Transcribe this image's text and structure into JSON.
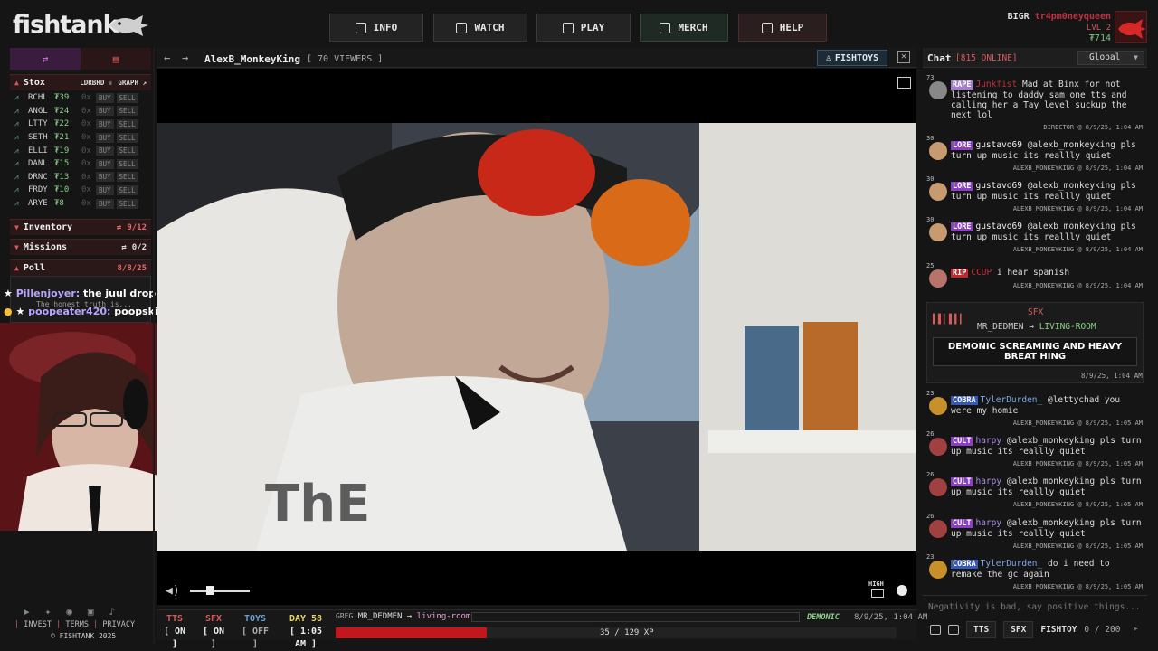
{
  "brand": {
    "logo_text": "fishtank"
  },
  "nav": {
    "info": "INFO",
    "watch": "WATCH",
    "play": "PLAY",
    "merch": "MERCH",
    "help": "HELP"
  },
  "user": {
    "name_prefix": "BIGR",
    "name": "tr4pm0neyqueen",
    "level": "LVL 2",
    "coins": "₮714"
  },
  "left_panel": {
    "stox": {
      "title": "Stox",
      "leaderboard_label": "LDRBRD",
      "graph_label": "GRAPH",
      "rows": [
        {
          "ticker": "RCHL",
          "price": "₮39",
          "owned": "0x",
          "buy": "BUY",
          "sell": "SELL"
        },
        {
          "ticker": "ANGL",
          "price": "₮24",
          "owned": "0x",
          "buy": "BUY",
          "sell": "SELL"
        },
        {
          "ticker": "LTTY",
          "price": "₮22",
          "owned": "0x",
          "buy": "BUY",
          "sell": "SELL"
        },
        {
          "ticker": "SETH",
          "price": "₮21",
          "owned": "0x",
          "buy": "BUY",
          "sell": "SELL"
        },
        {
          "ticker": "ELLI",
          "price": "₮19",
          "owned": "0x",
          "buy": "BUY",
          "sell": "SELL"
        },
        {
          "ticker": "DANL",
          "price": "₮15",
          "owned": "0x",
          "buy": "BUY",
          "sell": "SELL"
        },
        {
          "ticker": "DRNC",
          "price": "₮13",
          "owned": "0x",
          "buy": "BUY",
          "sell": "SELL"
        },
        {
          "ticker": "FRDY",
          "price": "₮10",
          "owned": "0x",
          "buy": "BUY",
          "sell": "SELL"
        },
        {
          "ticker": "ARYE",
          "price": "₮8",
          "owned": "0x",
          "buy": "BUY",
          "sell": "SELL"
        }
      ]
    },
    "inventory": {
      "title": "Inventory",
      "count": "9/12"
    },
    "missions": {
      "title": "Missions",
      "count": "0/2"
    },
    "poll": {
      "title": "Poll",
      "date": "8/8/25"
    },
    "overlay_chat": [
      {
        "name": "Pillenjoyer:",
        "text": "the juul drop lol"
      },
      {
        "sub": "The honest truth is..."
      },
      {
        "name": "poopeater420:",
        "text": "poopskie!"
      }
    ]
  },
  "footer": {
    "links": [
      "INVEST",
      "TERMS",
      "PRIVACY"
    ],
    "copyright": "© FISHTANK 2025"
  },
  "video": {
    "title": "AlexB_MonkeyKing",
    "viewers": "[ 70 VIEWERS ]",
    "fishtoys_label": "FISHTOYS",
    "quality": "HIGH"
  },
  "status_bar": {
    "tts": {
      "label": "TTS",
      "value": "[ ON ]"
    },
    "sfx": {
      "label": "SFX",
      "value": "[ ON ]"
    },
    "toys": {
      "label": "TOYS",
      "value": "[ OFF ]"
    },
    "day": {
      "label": "DAY 58",
      "time": "[ 1:05 AM ]"
    },
    "sfx_now": {
      "prefix": "GREG",
      "from": "MR_DEDMEN",
      "arrow": "→",
      "room": "living-room",
      "tag": "DEMONIC",
      "time": "8/9/25, 1:04 AM"
    },
    "xp": {
      "text": "35 / 129 XP",
      "fraction": 0.27
    }
  },
  "chat": {
    "title": "Chat",
    "online": "[815 ONLINE]",
    "room": "Global",
    "messages": [
      {
        "level": "73",
        "badge": "RAPE",
        "user": "Junkfist",
        "text": "Mad at Binx for not listening to daddy sam one tts and calling her a Tay level suckup the next lol",
        "meta": "DIRECTOR @ 8/9/25, 1:04 AM"
      },
      {
        "level": "30",
        "badge": "LORE",
        "user": "gustavo69",
        "text": "@alexb_monkeyking pls turn up music its reallly quiet",
        "meta": "ALEXB_MONKEYKING @ 8/9/25, 1:04 AM"
      },
      {
        "level": "30",
        "badge": "LORE",
        "user": "gustavo69",
        "text": "@alexb_monkeyking pls turn up music its reallly quiet",
        "meta": "ALEXB_MONKEYKING @ 8/9/25, 1:04 AM"
      },
      {
        "level": "30",
        "badge": "LORE",
        "user": "gustavo69",
        "text": "@alexb_monkeyking pls turn up music its reallly quiet",
        "meta": "ALEXB_MONKEYKING @ 8/9/25, 1:04 AM"
      },
      {
        "level": "25",
        "badge": "RIP",
        "user": "CCUP",
        "text": "i hear spanish",
        "meta": "ALEXB_MONKEYKING @ 8/9/25, 1:04 AM"
      }
    ],
    "sfx_card": {
      "label": "SFX",
      "from": "MR_DEDMEN",
      "arrow": "→",
      "room": "LIVING-ROOM",
      "text": "DEMONIC SCREAMING AND HEAVY BREAT HING",
      "time": "8/9/25, 1:04 AM"
    },
    "messages2": [
      {
        "level": "23",
        "badge": "COBRA",
        "user": "TylerDurden_",
        "text": "@lettychad you were my homie",
        "meta": "ALEXB_MONKEYKING @ 8/9/25, 1:05 AM"
      },
      {
        "level": "26",
        "badge": "CULT",
        "user": "harpy",
        "text": "@alexb_monkeyking pls turn up music its reallly quiet",
        "meta": "ALEXB_MONKEYKING @ 8/9/25, 1:05 AM"
      },
      {
        "level": "26",
        "badge": "CULT",
        "user": "harpy",
        "text": "@alexb_monkeyking pls turn up music its reallly quiet",
        "meta": "ALEXB_MONKEYKING @ 8/9/25, 1:05 AM"
      },
      {
        "level": "26",
        "badge": "CULT",
        "user": "harpy",
        "text": "@alexb_monkeyking pls turn up music its reallly quiet",
        "meta": "ALEXB_MONKEYKING @ 8/9/25, 1:05 AM"
      },
      {
        "level": "23",
        "badge": "COBRA",
        "user": "TylerDurden_",
        "text": "do i need to remake the gc again",
        "meta": "ALEXB_MONKEYKING @ 8/9/25, 1:05 AM"
      }
    ],
    "input_placeholder": "Negativity is bad, say positive things...",
    "tools": {
      "tts": "TTS",
      "sfx": "SFX",
      "fishtoy": "FISHTOY",
      "count": "0 / 200"
    }
  }
}
